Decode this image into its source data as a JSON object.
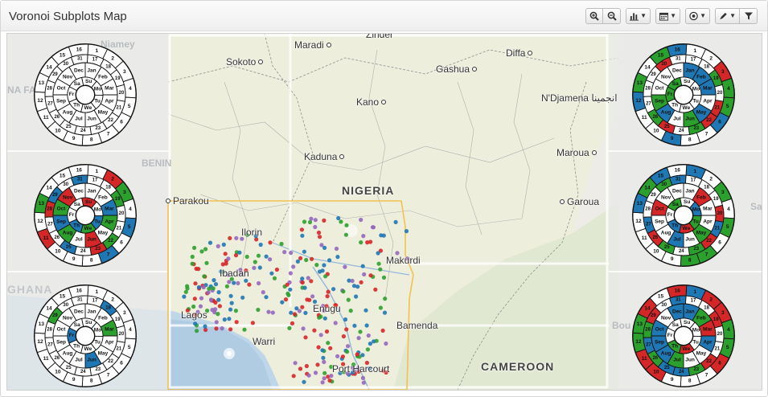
{
  "panel": {
    "title": "Voronoi Subplots Map"
  },
  "toolbar": {
    "buttons": [
      {
        "name": "zoom-in-button",
        "icon": "zoom-in-icon"
      },
      {
        "name": "zoom-out-button",
        "icon": "zoom-out-icon"
      },
      {
        "name": "chart-type-button",
        "icon": "bar-chart-icon"
      },
      {
        "name": "calendar-button",
        "icon": "calendar-icon"
      },
      {
        "name": "target-button",
        "icon": "target-icon"
      },
      {
        "name": "pencil-button",
        "icon": "pencil-icon"
      },
      {
        "name": "filter-button",
        "icon": "filter-icon"
      }
    ]
  },
  "map": {
    "labels": {
      "zinder": "Zinder",
      "maradi": "Maradi",
      "diffa": "Diffa",
      "niamey": "Niamey",
      "sokoto": "Sokoto",
      "gashua": "Gashua",
      "kano": "Kano",
      "ndjamena": "N'Djamena",
      "ndjamena_ar": "انجمينا",
      "kaduna": "Kaduna",
      "maroua": "Maroua",
      "nigeria": "NIGERIA",
      "parakou": "Parakou",
      "garoua": "Garoua",
      "ilorin": "Ilorin",
      "ibadan": "Ibadan",
      "makurdi": "Makurdi",
      "lagos": "Lagos",
      "enugu": "Enugu",
      "bamenda": "Bamenda",
      "warri": "Warri",
      "port_harcourt": "Port Harcourt",
      "cameroon": "CAMEROON",
      "benin": "BENIN",
      "ghana": "GHANA",
      "na_fa": "NA FA",
      "bou": "Bou",
      "sa": "Sa"
    },
    "dot_colors": [
      "#d62728",
      "#2ca02c",
      "#1f77b4",
      "#9467bd"
    ],
    "polygon_color": "#f2c14e"
  },
  "calendar": {
    "days": [
      "Su",
      "Mo",
      "Tu",
      "We",
      "Th",
      "Fr",
      "Sa"
    ],
    "months": [
      "Jan",
      "Feb",
      "Mar",
      "Apr",
      "May",
      "Jun",
      "Jul",
      "Aug",
      "Sep",
      "Oct",
      "Nov",
      "Dec"
    ],
    "dates": [
      "1",
      "2",
      "3",
      "4",
      "5",
      "6",
      "7",
      "8",
      "9",
      "10",
      "11",
      "12",
      "13",
      "14",
      "15",
      "16",
      "17",
      "18",
      "19",
      "20",
      "21",
      "22",
      "23",
      "24",
      "25",
      "26",
      "27",
      "28",
      "29",
      "30",
      "31"
    ],
    "fill_colors": [
      "#d62728",
      "#2ca02c",
      "#1f77b4"
    ]
  }
}
